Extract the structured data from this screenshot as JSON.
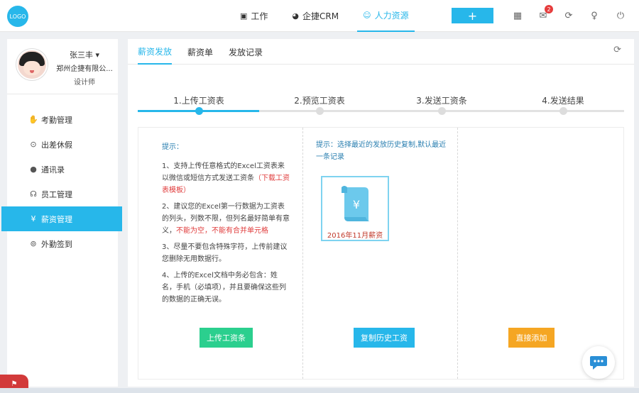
{
  "app": {
    "logo_text": "LOGO",
    "nav": [
      {
        "label": "工作",
        "icon": "briefcase-icon"
      },
      {
        "label": "企捷CRM",
        "icon": "pie-chart-icon"
      },
      {
        "label": "人力资源",
        "icon": "people-icon"
      }
    ],
    "add_label": "+",
    "mail_badge": "2"
  },
  "profile": {
    "name": "张三丰",
    "company": "郑州企捷有限公...",
    "role": "设计师"
  },
  "sidebar": {
    "items": [
      {
        "label": "考勤管理",
        "icon": "hand-icon"
      },
      {
        "label": "出差休假",
        "icon": "location-pin-icon"
      },
      {
        "label": "通讯录",
        "icon": "contact-icon"
      },
      {
        "label": "员工管理",
        "icon": "staff-icon"
      },
      {
        "label": "薪资管理",
        "icon": "yen-icon"
      },
      {
        "label": "外勤签到",
        "icon": "map-pin-icon"
      }
    ]
  },
  "tabs": [
    {
      "label": "薪资发放"
    },
    {
      "label": "薪资单"
    },
    {
      "label": "发放记录"
    }
  ],
  "steps": [
    {
      "label": "1.上传工资表"
    },
    {
      "label": "2.预览工资表"
    },
    {
      "label": "3.发送工资条"
    },
    {
      "label": "4.发送结果"
    }
  ],
  "current_step": 1,
  "upload_panel": {
    "tip_title": "提示：",
    "tip1_text": "1、支持上传任意格式的Excel工资表来以微信或短信方式发送工资条",
    "tip1_link": "（下载工资表模板）",
    "tip2_text": "2、建议您的Excel第一行数据为工资表的列头，列数不限，但列名最好简单有意义，",
    "tip2_warn": "不能为空，不能有合并单元格",
    "tip3_text": "3、尽量不要包含特殊字符，上传前建议您删除无用数据行。",
    "tip4_text": "4、上传的Excel文档中务必包含：姓名，手机（必填项），并且要确保这些列的数据的正确无误。",
    "button": "上传工资条"
  },
  "history_panel": {
    "tip": "提示：选择最近的发放历史复制,默认最近一条记录",
    "card_label": "2016年11月薪资",
    "button": "复制历史工资"
  },
  "direct_panel": {
    "button": "直接添加"
  },
  "colors": {
    "accent": "#27b7ea",
    "green": "#2bcf8e",
    "orange": "#f5a623",
    "warn": "#e03c3c"
  }
}
